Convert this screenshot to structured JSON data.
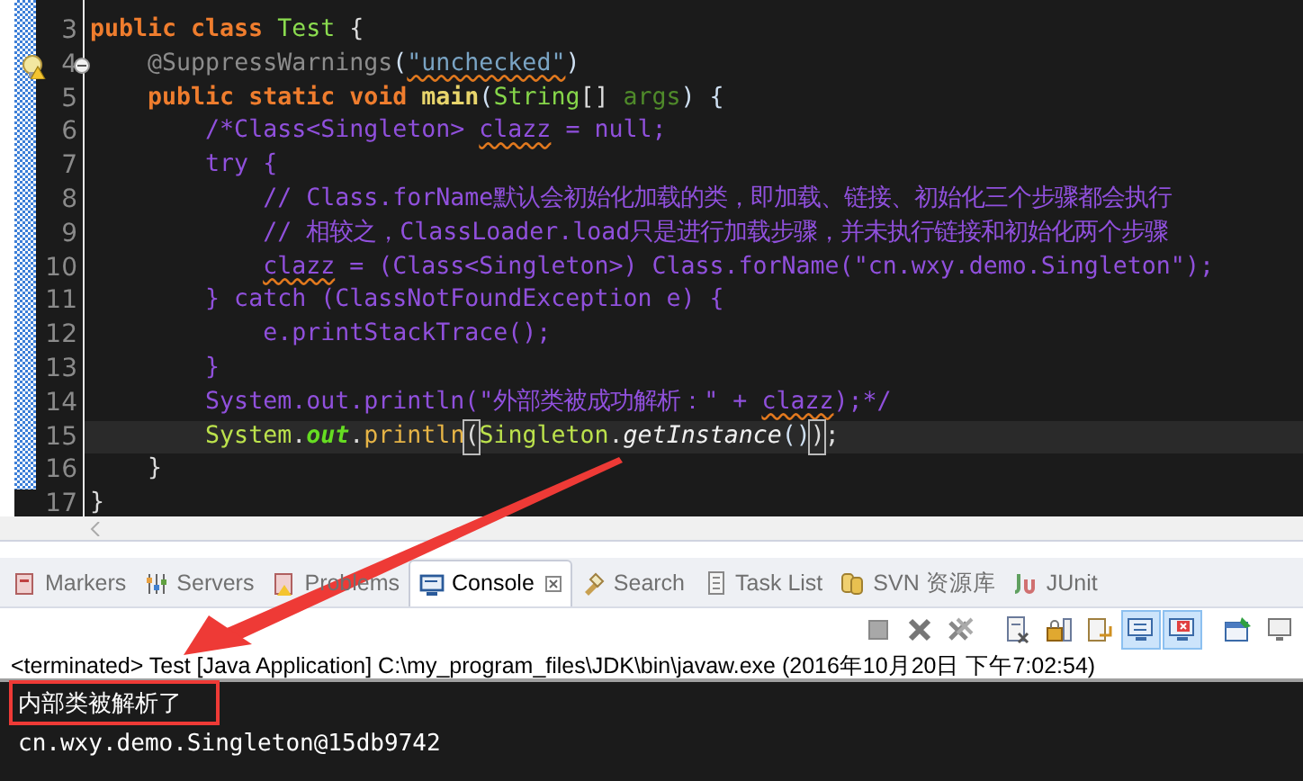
{
  "editor": {
    "lines": [
      {
        "number": "3",
        "tokens": [
          {
            "kind": "keyword",
            "text": "public class "
          },
          {
            "kind": "class",
            "text": "Test"
          },
          {
            "kind": "plain",
            "text": " {"
          }
        ]
      },
      {
        "number": "4",
        "warning": true,
        "tokens": [
          {
            "kind": "annotation",
            "text": "    @SuppressWarnings"
          },
          {
            "kind": "paren",
            "text": "("
          },
          {
            "kind": "string",
            "text": "\"unchecked\"",
            "squiggle": true
          },
          {
            "kind": "paren",
            "text": ")"
          }
        ]
      },
      {
        "number": "5",
        "tokens": [
          {
            "kind": "keyword",
            "text": "    public static void "
          },
          {
            "kind": "method",
            "text": "main"
          },
          {
            "kind": "paren",
            "text": "("
          },
          {
            "kind": "type",
            "text": "String"
          },
          {
            "kind": "plain",
            "text": "[] "
          },
          {
            "kind": "param",
            "text": "args"
          },
          {
            "kind": "paren",
            "text": ") {"
          }
        ]
      },
      {
        "number": "6",
        "tokens": [
          {
            "kind": "comment",
            "text": "        /*Class<Singleton> "
          },
          {
            "kind": "comment",
            "text": "clazz",
            "squiggle": true
          },
          {
            "kind": "comment",
            "text": " = null;"
          }
        ]
      },
      {
        "number": "7",
        "tokens": [
          {
            "kind": "comment",
            "text": "        try {"
          }
        ]
      },
      {
        "number": "8",
        "tokens": [
          {
            "kind": "comment",
            "text": "            // Class.forName默认会初始化加载的类，即加载、链接、初始化三个步骤都会执行"
          }
        ]
      },
      {
        "number": "9",
        "tokens": [
          {
            "kind": "comment",
            "text": "            // 相较之，ClassLoader.load只是进行加载步骤，并未执行链接和初始化两个步骤"
          }
        ]
      },
      {
        "number": "10",
        "tokens": [
          {
            "kind": "comment",
            "text": "            clazz",
            "squiggle": true
          },
          {
            "kind": "comment",
            "text": " = (Class<Singleton>) Class.forName(\"cn.wxy.demo.Singleton\");"
          }
        ]
      },
      {
        "number": "11",
        "tokens": [
          {
            "kind": "comment",
            "text": "        } catch (ClassNotFoundException e) {"
          }
        ]
      },
      {
        "number": "12",
        "tokens": [
          {
            "kind": "comment",
            "text": "            e.printStackTrace();"
          }
        ]
      },
      {
        "number": "13",
        "tokens": [
          {
            "kind": "comment",
            "text": "        }"
          }
        ]
      },
      {
        "number": "14",
        "tokens": [
          {
            "kind": "comment",
            "text": "        System.out.println(\"外部类被成功解析：\" + "
          },
          {
            "kind": "comment",
            "text": "clazz",
            "squiggle": true
          },
          {
            "kind": "comment",
            "text": ");*/"
          }
        ]
      },
      {
        "number": "15",
        "current": true,
        "tokens": [
          {
            "kind": "system",
            "text": "        System"
          },
          {
            "kind": "plain",
            "text": "."
          },
          {
            "kind": "field",
            "text": "out"
          },
          {
            "kind": "plain",
            "text": "."
          },
          {
            "kind": "call",
            "text": "println"
          },
          {
            "kind": "match",
            "text": "("
          },
          {
            "kind": "system",
            "text": "Singleton"
          },
          {
            "kind": "plain",
            "text": "."
          },
          {
            "kind": "static",
            "text": "getInstance"
          },
          {
            "kind": "paren",
            "text": "()"
          },
          {
            "kind": "match",
            "text": ")"
          },
          {
            "kind": "plain",
            "text": ";"
          }
        ]
      },
      {
        "number": "16",
        "tokens": [
          {
            "kind": "plain",
            "text": "    }"
          }
        ]
      },
      {
        "number": "17",
        "tokens": [
          {
            "kind": "plain",
            "text": "}"
          }
        ]
      }
    ]
  },
  "views": {
    "tabs": [
      {
        "label": "Markers",
        "selected": false
      },
      {
        "label": "Servers",
        "selected": false
      },
      {
        "label": "Problems",
        "selected": false
      },
      {
        "label": "Console",
        "selected": true
      },
      {
        "label": "Search",
        "selected": false
      },
      {
        "label": "Task List",
        "selected": false
      },
      {
        "label": "SVN 资源库",
        "selected": false
      },
      {
        "label": "JUnit",
        "selected": false
      }
    ],
    "toolbar": [
      {
        "on": false
      },
      {
        "on": false
      },
      {
        "on": false
      },
      {
        "on": false
      },
      {
        "on": false
      },
      {
        "on": false
      },
      {
        "on": true
      },
      {
        "on": true
      },
      {
        "on": false
      },
      {
        "on": false
      }
    ]
  },
  "console": {
    "header": "<terminated> Test [Java Application] C:\\my_program_files\\JDK\\bin\\javaw.exe (2016年10月20日 下午7:02:54)",
    "output": [
      {
        "text": "内部类被解析了",
        "highlighted": true
      },
      {
        "text": "cn.wxy.demo.Singleton@15db9742",
        "highlighted": false
      }
    ]
  }
}
